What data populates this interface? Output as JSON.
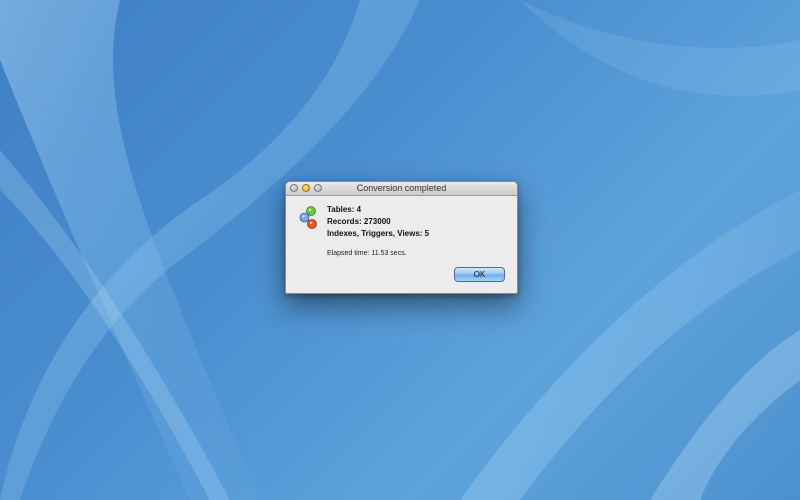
{
  "dialog": {
    "title": "Conversion completed",
    "icon": "database-conversion-icon",
    "stats": [
      "Tables: 4",
      "Records: 273000",
      "Indexes, Triggers, Views: 5"
    ],
    "elapsed": "Elapsed time: 11.53 secs.",
    "ok_label": "OK"
  },
  "colors": {
    "desktop_blue": "#4a8fd0",
    "dialog_bg": "#ececec",
    "button_blue": "#93c2ef"
  }
}
